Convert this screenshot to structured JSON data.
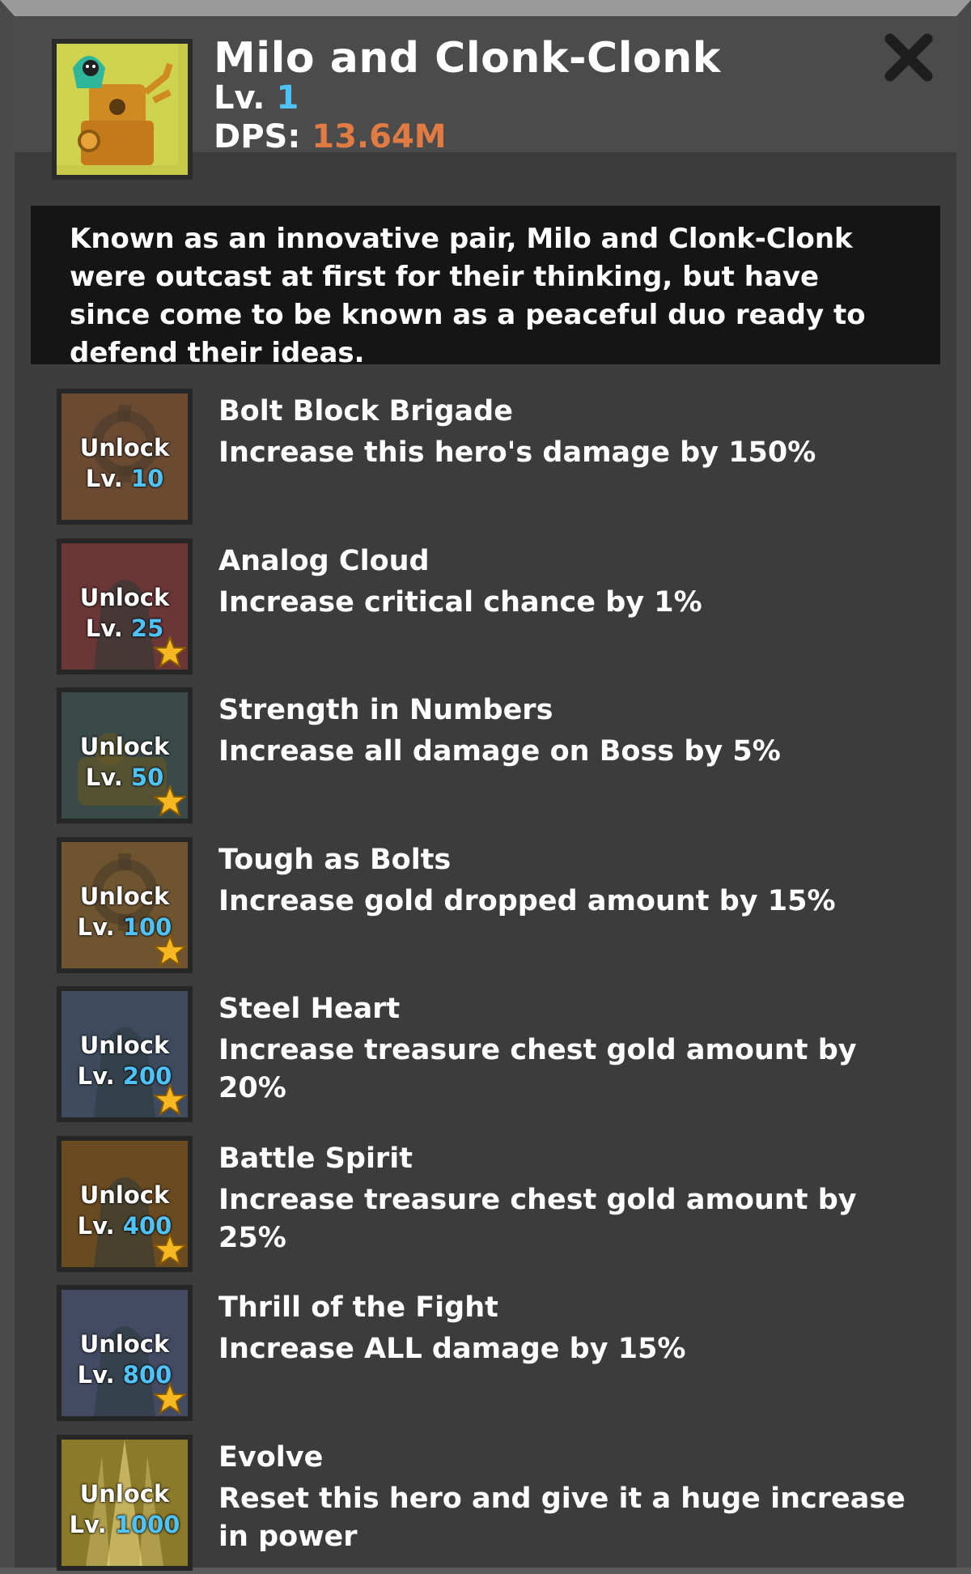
{
  "hero": {
    "name": "Milo and Clonk-Clonk",
    "level_label": "Lv.",
    "level": "1",
    "dps_label": "DPS:",
    "dps": "13.64M",
    "description": "Known as an innovative pair, Milo and Clonk-Clonk were outcast at first for their thinking, but have since come to be known as a peaceful duo ready to defend their ideas."
  },
  "colors": {
    "level_accent": "#4fc3f7",
    "dps_accent": "#e07b44",
    "panel_bg": "#3c3c3c",
    "description_bg": "#151515",
    "star": "#f5b820"
  },
  "unlock_label": "Unlock",
  "lv_prefix": "Lv.",
  "skills": [
    {
      "unlock_level": "10",
      "name": "Bolt Block Brigade",
      "desc": "Increase this hero's damage by 150%",
      "icon": "gear-icon",
      "star": false
    },
    {
      "unlock_level": "25",
      "name": "Analog Cloud",
      "desc": "Increase critical chance by 1%",
      "icon": "hooded-figure-icon",
      "star": true
    },
    {
      "unlock_level": "50",
      "name": "Strength in Numbers",
      "desc": "Increase all damage on Boss by 5%",
      "icon": "robot-arm-icon",
      "star": true
    },
    {
      "unlock_level": "100",
      "name": "Tough as Bolts",
      "desc": "Increase gold dropped amount by 15%",
      "icon": "gear-icon",
      "star": true
    },
    {
      "unlock_level": "200",
      "name": "Steel Heart",
      "desc": "Increase treasure chest gold amount by 20%",
      "icon": "hooded-figure-icon",
      "star": true
    },
    {
      "unlock_level": "400",
      "name": "Battle Spirit",
      "desc": "Increase treasure chest gold amount by 25%",
      "icon": "hooded-figure-icon",
      "star": true
    },
    {
      "unlock_level": "800",
      "name": "Thrill of the Fight",
      "desc": "Increase ALL damage by 15%",
      "icon": "hooded-figure-icon",
      "star": true
    },
    {
      "unlock_level": "1000",
      "name": "Evolve",
      "desc": "Reset this hero and give it a huge increase in power",
      "icon": "evolve-glow-icon",
      "star": false
    }
  ]
}
